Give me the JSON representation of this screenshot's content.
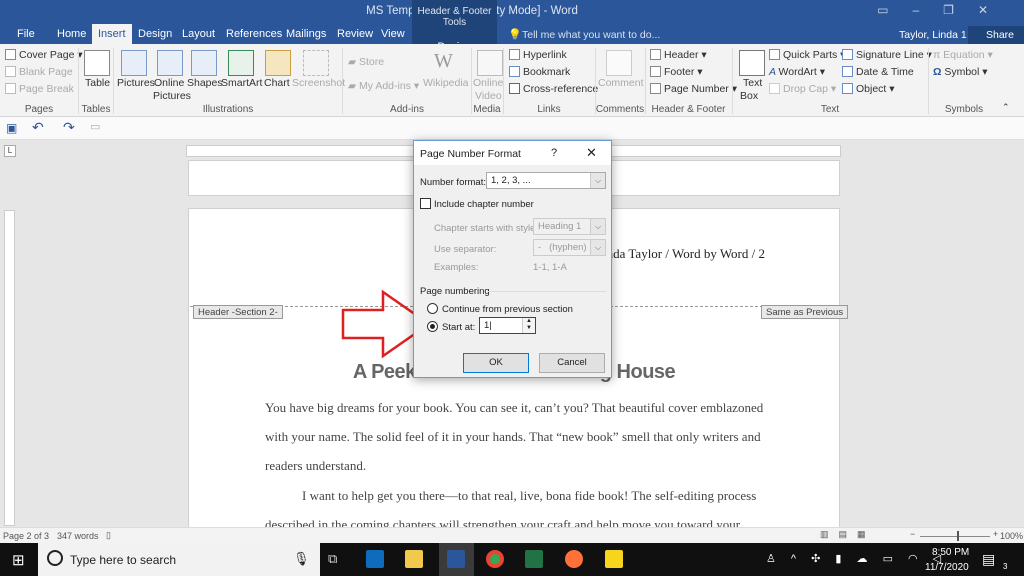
{
  "window": {
    "title": "MS Template [Compatibility Mode] - Word",
    "context_tools": "Header & Footer Tools",
    "user": "Taylor, Linda 1",
    "share": "Share",
    "tell_me": "Tell me what you want to do..."
  },
  "tabs": [
    "File",
    "Home",
    "Insert",
    "Design",
    "Layout",
    "References",
    "Mailings",
    "Review",
    "View"
  ],
  "context_tab": "Design",
  "ribbon": {
    "pages": {
      "cover": "Cover Page",
      "blank": "Blank Page",
      "break": "Page Break",
      "label": "Pages"
    },
    "tables": {
      "table": "Table",
      "label": "Tables"
    },
    "illustrations": {
      "pictures": "Pictures",
      "online1": "Online",
      "online2": "Pictures",
      "shapes": "Shapes",
      "smartart": "SmartArt",
      "chart": "Chart",
      "screenshot": "Screenshot",
      "label": "Illustrations"
    },
    "addins": {
      "store": "Store",
      "my": "My Add-ins",
      "wiki": "Wikipedia",
      "label": "Add-ins"
    },
    "media": {
      "v1": "Online",
      "v2": "Video",
      "label": "Media"
    },
    "links": {
      "hyperlink": "Hyperlink",
      "bookmark": "Bookmark",
      "xref": "Cross-reference",
      "label": "Links"
    },
    "comments": {
      "comment": "Comment",
      "label": "Comments"
    },
    "hf": {
      "header": "Header",
      "footer": "Footer",
      "pagenum": "Page Number",
      "label": "Header & Footer"
    },
    "text": {
      "tb1": "Text",
      "tb2": "Box",
      "quick": "Quick Parts",
      "wordart": "WordArt",
      "dropcap": "Drop Cap",
      "sig": "Signature Line",
      "date": "Date & Time",
      "object": "Object",
      "label": "Text"
    },
    "symbols": {
      "equation": "Equation",
      "symbol": "Symbol",
      "label": "Symbols"
    }
  },
  "document": {
    "header_text": "Linda Taylor / Word by Word / 2",
    "header_tag": "Header -Section 2-",
    "same_as_previous": "Same as Previous",
    "heading": "A Peek Inside the Publishing House",
    "lines": [
      "You have big dreams for your book. You can see it, can’t you? That beautiful cover emblazoned",
      "with your name. The solid feel of it in your hands. That “new book” smell that only writers and",
      "readers understand.",
      "I want to help get you there—to that real, live, bona fide book! The self-editing process",
      "described in the coming chapters will strengthen your craft and help move you toward your"
    ]
  },
  "dialog": {
    "title": "Page Number Format",
    "help": "?",
    "number_format_label": "Number format:",
    "number_format": "1, 2, 3, ...",
    "include_chapter": "Include chapter number",
    "chapter_style_label": "Chapter starts with style:",
    "chapter_style": "Heading 1",
    "separator_label": "Use separator:",
    "separator": "-   (hyphen)",
    "examples_label": "Examples:",
    "examples": "1-1, 1-A",
    "page_numbering": "Page numbering",
    "continue": "Continue from previous section",
    "start_at": "Start at:",
    "start_value": "1",
    "ok": "OK",
    "cancel": "Cancel"
  },
  "status": {
    "page": "Page 2 of 3",
    "words": "347 words",
    "zoom": "100%"
  },
  "taskbar": {
    "search": "Type here to search",
    "time": "8:50 PM",
    "date": "11/7/2020",
    "notifications": "3"
  },
  "colors": {
    "word_blue": "#2b579a",
    "arrow_red": "#e02020"
  }
}
